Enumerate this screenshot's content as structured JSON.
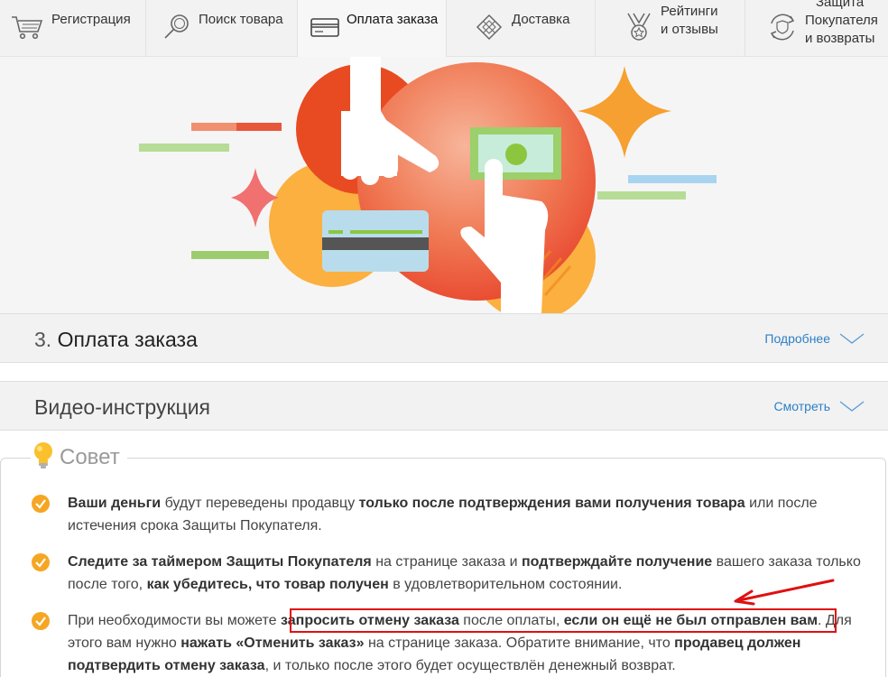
{
  "nav": {
    "items": [
      {
        "label": "Регистрация",
        "icon": "cart-icon"
      },
      {
        "label": "Поиск товара",
        "icon": "magnifier-icon"
      },
      {
        "label": "Оплата заказа",
        "icon": "card-icon",
        "active": true
      },
      {
        "label": "Доставка",
        "icon": "box-icon"
      },
      {
        "label_line1": "Рейтинги",
        "label_line2": "и отзывы",
        "icon": "medal-icon"
      },
      {
        "label_line0": "Защита",
        "label_line1": "Покупателя",
        "label_line2": "и возвраты",
        "icon": "shield-return-icon"
      }
    ]
  },
  "section_payment": {
    "number": "3.",
    "title": "Оплата заказа",
    "more_label": "Подробнее"
  },
  "section_video": {
    "title": "Видео-инструкция",
    "more_label": "Смотреть"
  },
  "tip": {
    "title": "Совет",
    "items": [
      {
        "parts": [
          {
            "t": "Ваши деньги",
            "b": true
          },
          {
            "t": " будут переведены продавцу ",
            "b": false
          },
          {
            "t": "только после подтверждения вами получения товара",
            "b": true
          },
          {
            "t": " или после истечения срока Защиты Покупателя.",
            "b": false
          }
        ]
      },
      {
        "parts": [
          {
            "t": "Следите за таймером Защиты Покупателя",
            "b": true
          },
          {
            "t": " на странице заказа и ",
            "b": false
          },
          {
            "t": "подтверждайте получение",
            "b": true
          },
          {
            "t": " вашего заказа только после того, ",
            "b": false
          },
          {
            "t": "как убедитесь, что товар получен",
            "b": true
          },
          {
            "t": " в удовлетворительном состоянии.",
            "b": false
          }
        ]
      },
      {
        "parts": [
          {
            "t": "При необходимости вы можете ",
            "b": false
          },
          {
            "t": "запросить отмену заказа",
            "b": true
          },
          {
            "t": " после оплаты, ",
            "b": false
          },
          {
            "t": "если он ещё не был отправлен вам",
            "b": true
          },
          {
            "t": ". Для этого вам нужно ",
            "b": false
          },
          {
            "t": "нажать «Отменить заказ»",
            "b": true
          },
          {
            "t": " на странице заказа. Обратите внимание, что ",
            "b": false
          },
          {
            "t": "продавец должен подтвердить отмену заказа",
            "b": true
          },
          {
            "t": ", и только после этого будет осуществлён денежный возврат.",
            "b": false
          }
        ]
      }
    ]
  },
  "colors": {
    "accent_orange": "#f5a623",
    "link_blue": "#2c7fc6",
    "highlight_red": "#e01010"
  }
}
